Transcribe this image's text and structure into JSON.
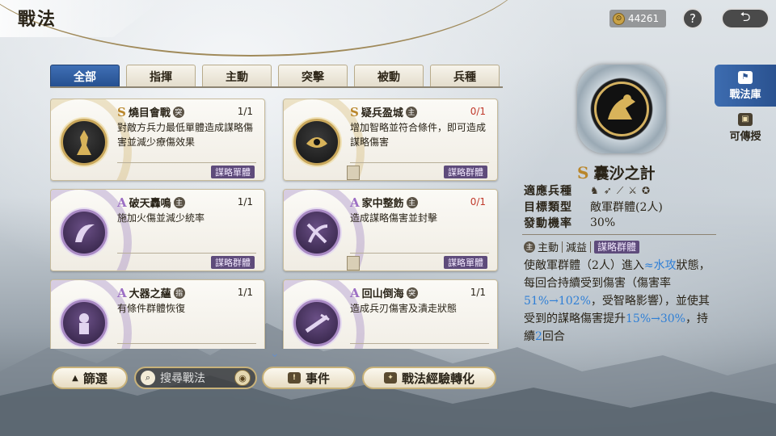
{
  "header": {
    "title": "戰法",
    "currency": "44261",
    "help": "?",
    "back": "⮌"
  },
  "tabs": [
    {
      "label": "全部",
      "active": true
    },
    {
      "label": "指揮",
      "active": false
    },
    {
      "label": "主動",
      "active": false
    },
    {
      "label": "突擊",
      "active": false
    },
    {
      "label": "被動",
      "active": false
    },
    {
      "label": "兵種",
      "active": false
    }
  ],
  "cards": [
    {
      "grade": "S",
      "name": "燒目會戰",
      "type_icon": "突",
      "count": "1/1",
      "desc": "對敵方兵力最低單體造成謀略傷害並減少療傷效果",
      "tag": "謀略單體"
    },
    {
      "grade": "S",
      "name": "疑兵盈城",
      "type_icon": "主",
      "count": "0/1",
      "desc": "增加智略並符合條件，即可造成謀略傷害",
      "tag": "謀略群體"
    },
    {
      "grade": "A",
      "name": "破天轟鳴",
      "type_icon": "主",
      "count": "1/1",
      "desc": "施加火傷並減少統率",
      "tag": "謀略群體"
    },
    {
      "grade": "A",
      "name": "家中整飭",
      "type_icon": "主",
      "count": "0/1",
      "desc": "造成謀略傷害並封擊",
      "tag": "謀略單體"
    },
    {
      "grade": "A",
      "name": "大器之蘊",
      "type_icon": "指",
      "count": "1/1",
      "desc": "有條件群體恢復",
      "tag": ""
    },
    {
      "grade": "A",
      "name": "回山倒海",
      "type_icon": "突",
      "count": "1/1",
      "desc": "造成兵刃傷害及潰走狀態",
      "tag": ""
    }
  ],
  "bottom": {
    "filter_label": "篩選",
    "search_placeholder": "搜尋戰法",
    "event_label": "事件",
    "convert_label": "戰法經驗轉化"
  },
  "detail": {
    "grade": "S",
    "name": "囊沙之計",
    "rows": [
      {
        "label": "適應兵種",
        "value": ""
      },
      {
        "label": "目標類型",
        "value": "敵軍群體(2人)"
      },
      {
        "label": "發動機率",
        "value": "30%"
      }
    ],
    "unit_icons": [
      "horse-icon",
      "bow-icon",
      "spear-icon",
      "sword-icon",
      "shield-icon"
    ],
    "tags": {
      "type": "主動",
      "effect": "減益",
      "category": "謀略群體"
    },
    "desc_parts": [
      {
        "text": "使敵軍群體（2人）進入",
        "hl": false
      },
      {
        "text": "≈水攻",
        "hl": true
      },
      {
        "text": "狀態，每回合持續受到傷害（傷害率",
        "hl": false
      },
      {
        "text": "51%→102%",
        "hl": true
      },
      {
        "text": "，受智略影響），並使其受到的謀略傷害提升",
        "hl": false
      },
      {
        "text": "15%→30%",
        "hl": true
      },
      {
        "text": "，持續",
        "hl": false
      },
      {
        "text": "2",
        "hl": true
      },
      {
        "text": "回合",
        "hl": false
      }
    ]
  },
  "side_menu": [
    {
      "label": "戰法庫",
      "active": true
    },
    {
      "label": "可傳授",
      "active": false
    }
  ]
}
